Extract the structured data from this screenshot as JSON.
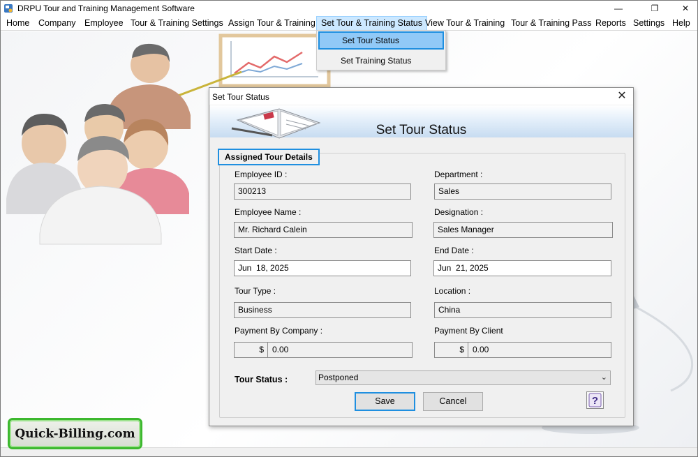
{
  "window": {
    "title": "DRPU Tour and Training Management Software",
    "minimize": "—",
    "maximize": "❐",
    "close": "✕"
  },
  "menu": {
    "items": [
      {
        "label": "Home"
      },
      {
        "label": "Company"
      },
      {
        "label": "Employee"
      },
      {
        "label": "Tour & Training Settings"
      },
      {
        "label": "Assign Tour & Training"
      },
      {
        "label": "Set Tour & Training Status"
      },
      {
        "label": "View Tour & Training"
      },
      {
        "label": "Tour & Training Pass"
      },
      {
        "label": "Reports"
      },
      {
        "label": "Settings"
      },
      {
        "label": "Help"
      }
    ],
    "open_index": 5
  },
  "dropdown": {
    "items": [
      {
        "label": "Set Tour Status",
        "highlighted": true
      },
      {
        "label": "Set Training Status",
        "highlighted": false
      }
    ]
  },
  "dialog": {
    "title": "Set Tour Status",
    "close": "✕",
    "banner_title": "Set Tour Status",
    "group_title": "Assigned Tour Details",
    "fields": {
      "employee_id": {
        "label": "Employee ID :",
        "value": "300213"
      },
      "department": {
        "label": "Department :",
        "value": "Sales"
      },
      "employee_name": {
        "label": "Employee Name :",
        "value": "Mr. Richard Calein"
      },
      "designation": {
        "label": "Designation :",
        "value": "Sales Manager"
      },
      "start_date": {
        "label": "Start Date :",
        "value": "Jun  18, 2025"
      },
      "end_date": {
        "label": "End Date :",
        "value": "Jun  21, 2025"
      },
      "tour_type": {
        "label": "Tour Type :",
        "value": "Business"
      },
      "location": {
        "label": "Location :",
        "value": "China"
      },
      "payment_company": {
        "label": "Payment By Company :",
        "currency": "$",
        "value": "0.00"
      },
      "payment_client": {
        "label": "Payment By Client",
        "currency": "$",
        "value": "0.00"
      }
    },
    "tour_status": {
      "label": "Tour Status :",
      "value": "Postponed"
    },
    "buttons": {
      "save": "Save",
      "cancel": "Cancel",
      "help": "?"
    }
  },
  "brand": {
    "text": "Quick-Billing.com"
  },
  "colors": {
    "accent": "#1f8fe0",
    "menu_active": "#cce8ff",
    "dropdown_highlight": "#91c9f7",
    "brand_border": "#3cb82e"
  }
}
